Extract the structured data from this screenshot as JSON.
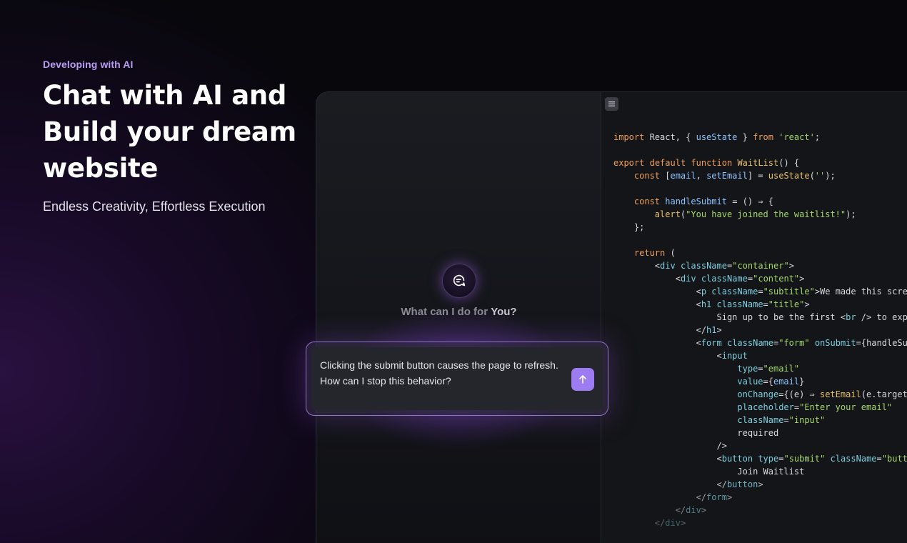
{
  "hero": {
    "eyebrow": "Developing with AI",
    "headline_lines": [
      "Chat with AI and",
      "Build your dream",
      "website"
    ],
    "subline": "Endless Creativity, Effortless Execution"
  },
  "chat": {
    "prompt_title_dim": "What can I do for ",
    "prompt_title_bright": "You?",
    "composer_text_line1": "Clicking the submit button causes the page to refresh.",
    "composer_text_line2": "How can I stop this behavior?",
    "send_icon": "arrow-up-icon",
    "assistant_icon": "chat-sparkle-icon"
  },
  "code": {
    "menu_icon": "menu-icon",
    "lines": [
      "import React, { useState } from 'react';",
      "",
      "export default function WaitList() {",
      "    const [email, setEmail] = useState('');",
      "",
      "    const handleSubmit = () ⇒ {",
      "        alert(\"You have joined the waitlist!\");",
      "    };",
      "",
      "    return (",
      "        <div className=\"container\">",
      "            <div className=\"content\">",
      "                <p className=\"subtitle\">We made this scre",
      "                <h1 className=\"title\">",
      "                    Sign up to be the first <br /> to expe",
      "                </h1>",
      "                <form className=\"form\" onSubmit={handleSub",
      "                    <input",
      "                        type=\"email\"",
      "                        value={email}",
      "                        onChange={(e) ⇒ setEmail(e.target",
      "                        placeholder=\"Enter your email\"",
      "                        className=\"input\"",
      "                        required",
      "                    />",
      "                    <button type=\"submit\" className=\"butto",
      "                        Join Waitlist",
      "                    </button>",
      "                </form>",
      "            </div>",
      "        </div>"
    ]
  },
  "colors": {
    "accent": "#9d7bf0",
    "eyebrow": "#b99cf5",
    "background": "#08070c"
  }
}
